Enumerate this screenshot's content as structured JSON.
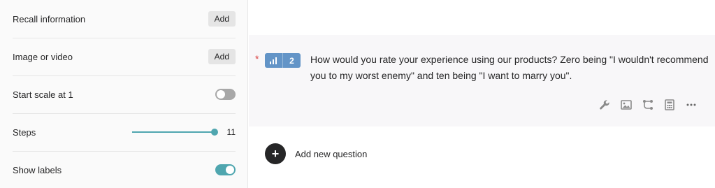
{
  "settings": {
    "recall": {
      "label": "Recall information",
      "button": "Add"
    },
    "media": {
      "label": "Image or video",
      "button": "Add"
    },
    "start_scale": {
      "label": "Start scale at 1",
      "enabled": false
    },
    "steps": {
      "label": "Steps",
      "value": "11",
      "slider_fraction": 1.0
    },
    "show_labels": {
      "label": "Show labels",
      "enabled": true
    }
  },
  "question": {
    "required_marker": "*",
    "type_icon": "opinion-scale-icon",
    "number": "2",
    "text": "How would you rate your experience using our products? Zero being \"I wouldn't recommend you to my worst enemy\" and ten being \"I want to marry you\".",
    "tools": [
      "wrench-icon",
      "image-icon",
      "branching-icon",
      "calculator-icon",
      "more-icon"
    ]
  },
  "add_question": {
    "icon": "plus-icon",
    "label": "Add new question"
  },
  "colors": {
    "accent": "#4fa6af",
    "badge": "#6394c7",
    "required": "#d93b3b",
    "dark": "#262627"
  }
}
